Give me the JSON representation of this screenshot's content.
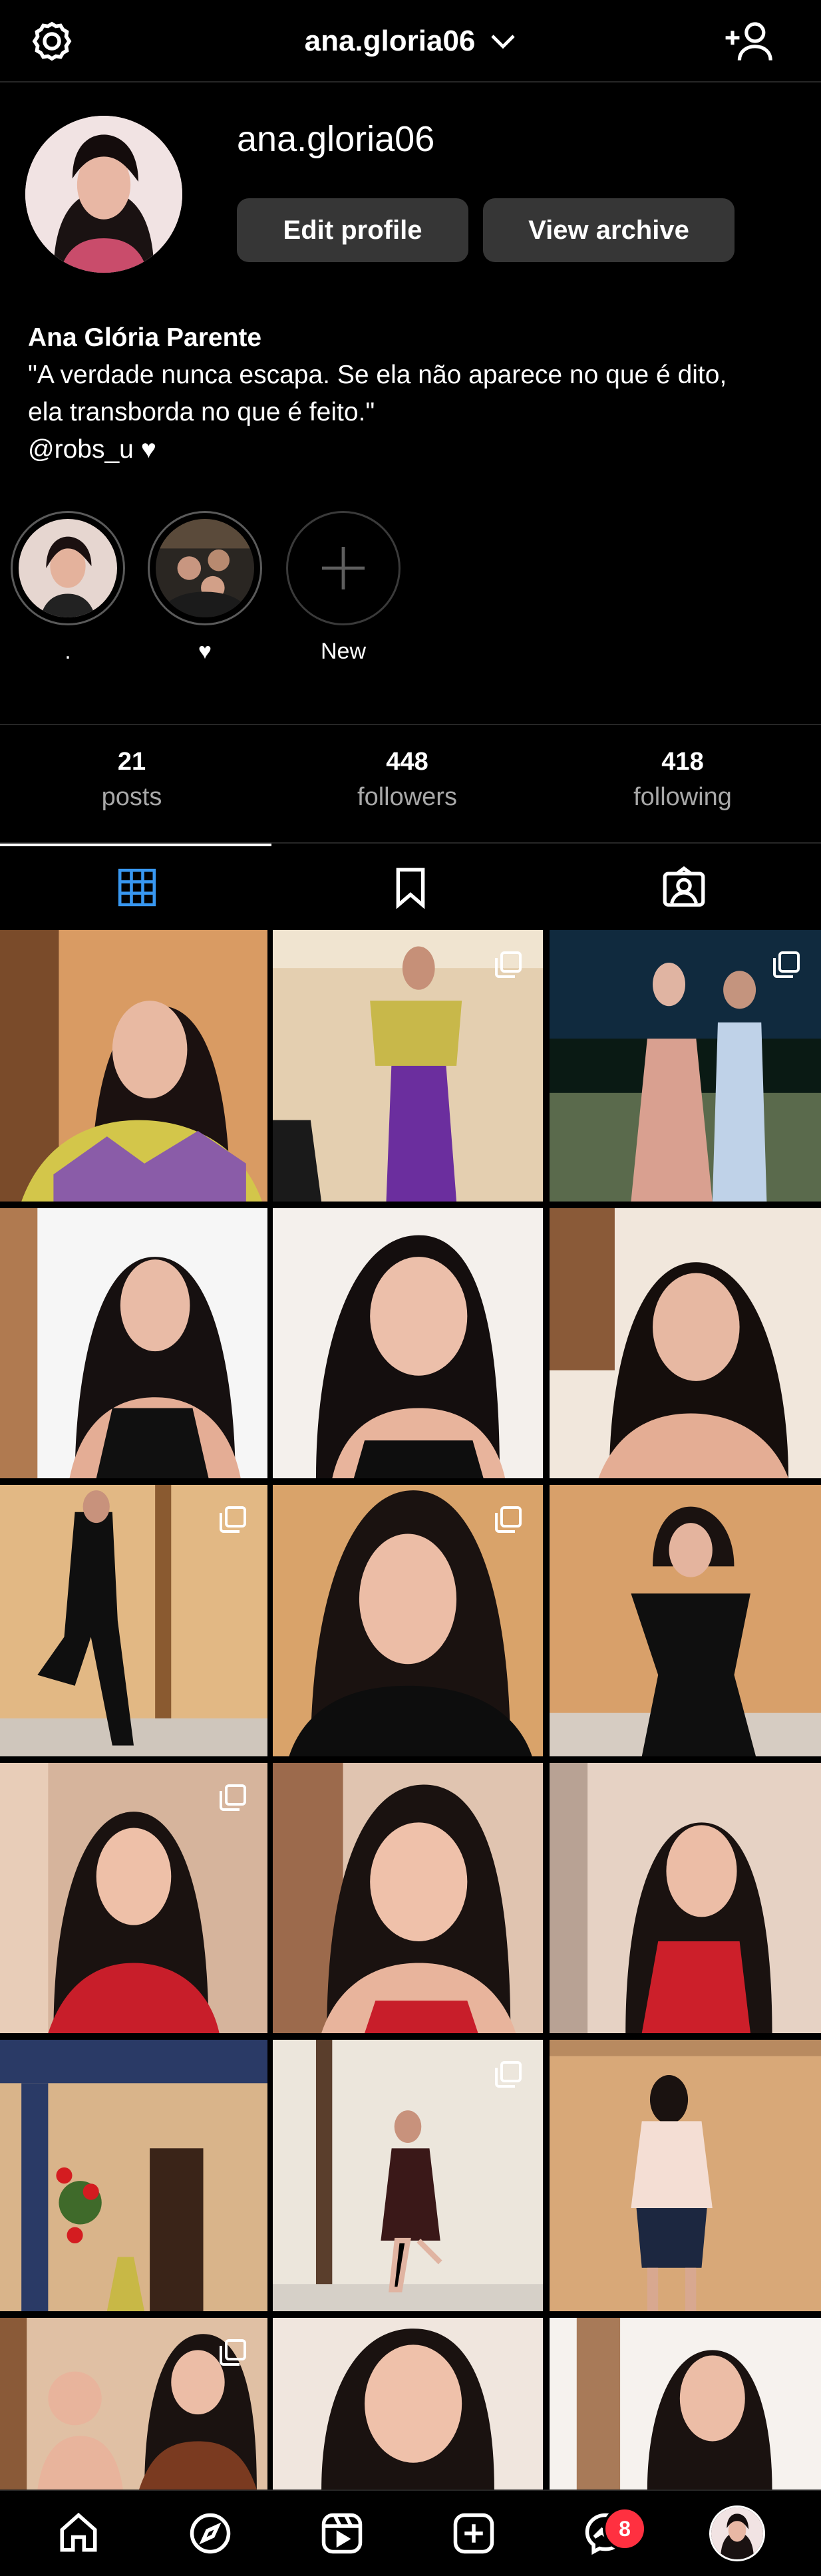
{
  "header": {
    "username": "ana.gloria06",
    "settings_icon": "gear-icon",
    "chevron_icon": "chevron-down-icon",
    "add_person_icon": "add-person-icon"
  },
  "profile": {
    "username": "ana.gloria06",
    "edit_profile_label": "Edit profile",
    "view_archive_label": "View archive",
    "full_name": "Ana Glória Parente",
    "bio_line1": "\"A verdade nunca escapa. Se ela não aparece no que é dito,",
    "bio_line2": "ela transborda no que é feito.\"",
    "bio_mention": "@robs_u",
    "bio_heart": "♥"
  },
  "highlights": [
    {
      "label": "."
    },
    {
      "label": "♥"
    },
    {
      "label": "New"
    }
  ],
  "stats": {
    "posts_count": "21",
    "posts_label": "posts",
    "followers_count": "448",
    "followers_label": "followers",
    "following_count": "418",
    "following_label": "following"
  },
  "tabs": {
    "active_color": "#3897f0",
    "items": [
      "grid-icon",
      "saved-icon",
      "tagged-icon"
    ]
  },
  "bottom_nav": {
    "items": [
      "home-icon",
      "explore-icon",
      "reels-icon",
      "create-icon",
      "messenger-icon",
      "profile-avatar"
    ],
    "messenger_badge": "8"
  },
  "colors": {
    "background": "#000000",
    "button_bg": "#363636",
    "muted_text": "#a8a8a8",
    "badge": "#ff3040"
  }
}
